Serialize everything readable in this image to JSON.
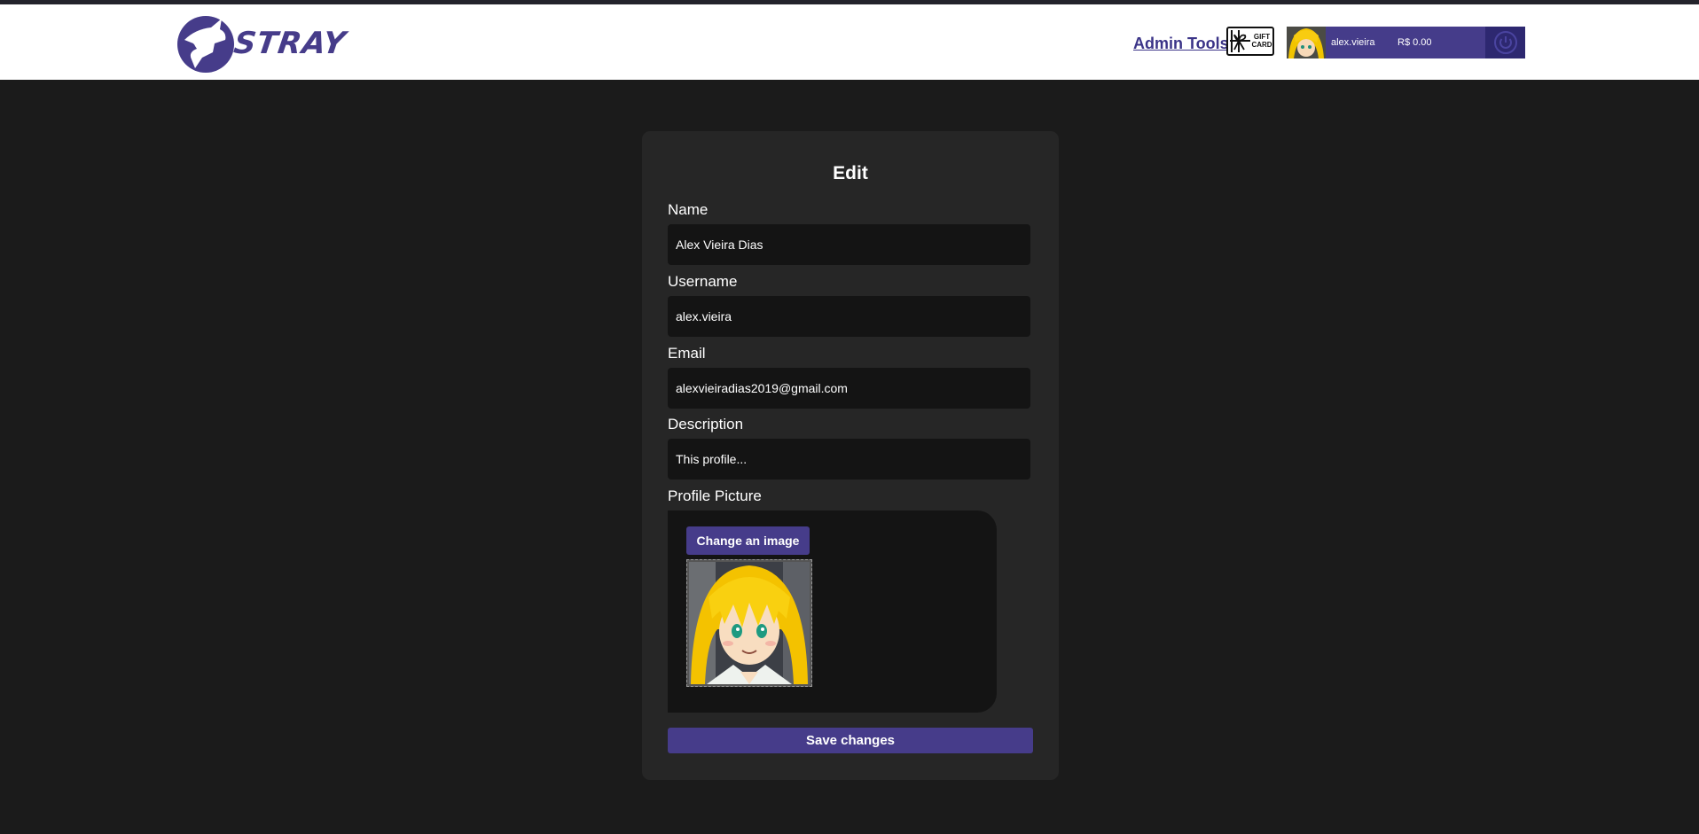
{
  "header": {
    "brand": "STRAY",
    "admin_link": "Admin Tools",
    "gift_card_text": "GIFT CARD",
    "user": {
      "username": "alex.vieira",
      "balance": "R$ 0.00"
    }
  },
  "form": {
    "title": "Edit",
    "name": {
      "label": "Name",
      "value": "Alex Vieira Dias"
    },
    "username": {
      "label": "Username",
      "value": "alex.vieira"
    },
    "email": {
      "label": "Email",
      "value": "alexvieiradias2019@gmail.com"
    },
    "description": {
      "label": "Description",
      "value": "This profile..."
    },
    "picture": {
      "label": "Profile Picture",
      "change_button": "Change an image"
    },
    "save_button": "Save changes"
  },
  "colors": {
    "accent": "#463c8a",
    "page_bg": "#1b1b1b",
    "card_bg": "#262626",
    "field_bg": "#141414"
  },
  "icons": [
    "stray-logo",
    "gift-card-icon",
    "avatar",
    "power-icon"
  ]
}
